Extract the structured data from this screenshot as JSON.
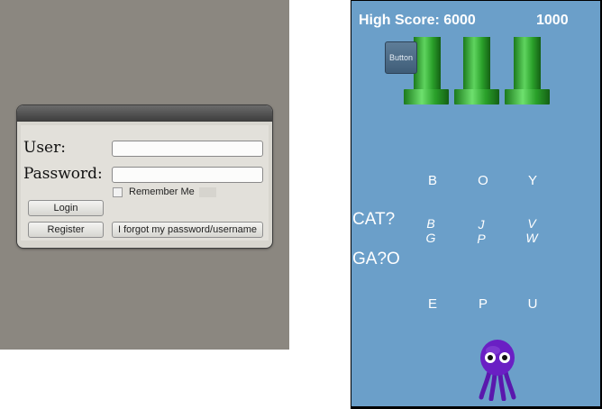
{
  "login": {
    "user_label": "User:",
    "password_label": "Password:",
    "user_value": "",
    "password_value": "",
    "remember_label": "Remember Me",
    "login_button": "Login",
    "register_button": "Register",
    "forgot_button": "I forgot my password/username"
  },
  "game": {
    "high_score": "High Score: 6000",
    "score": "1000",
    "button_label": "Button",
    "top_letters": [
      "B",
      "O",
      "Y"
    ],
    "bottom_letters": [
      "E",
      "P",
      "U"
    ],
    "choices": [
      {
        "top": "B",
        "bottom": "G"
      },
      {
        "top": "J",
        "bottom": "P"
      },
      {
        "top": "V",
        "bottom": "W"
      }
    ],
    "word1": "CAT?",
    "word2": "GA?O",
    "colors": {
      "sky": "#6b9fc9",
      "pipe": "#2aa02a",
      "octopus": "#6a1fc4"
    },
    "icons": [
      "octopus-character",
      "pipe-obstacle"
    ]
  }
}
